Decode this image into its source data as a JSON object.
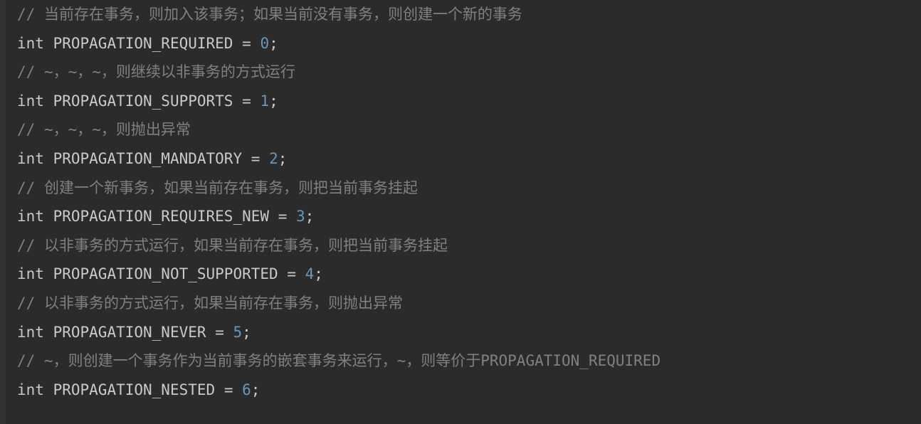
{
  "editor": {
    "theme_name": "darcula",
    "colors": {
      "background": "#2b2b2b",
      "gutter": "#313335",
      "comment": "#808080",
      "code_text": "#c9c9c9",
      "number_literal": "#6897bb"
    },
    "language": "java",
    "lines": [
      {
        "index": 1,
        "type": "comment",
        "slashes": "//",
        "text": " 当前存在事务，则加入该事务；如果当前没有事务，则创建一个新的事务",
        "full": "// 当前存在事务，则加入该事务；如果当前没有事务，则创建一个新的事务"
      },
      {
        "index": 2,
        "type": "code",
        "keyword": "int",
        "identifier": "PROPAGATION_REQUIRED",
        "operator": "=",
        "value": "0",
        "terminator": ";",
        "full": "int PROPAGATION_REQUIRED = 0;"
      },
      {
        "index": 3,
        "type": "comment",
        "slashes": "//",
        "text": " ~，~，~，则继续以非事务的方式运行",
        "full": "// ~，~，~，则继续以非事务的方式运行"
      },
      {
        "index": 4,
        "type": "code",
        "keyword": "int",
        "identifier": "PROPAGATION_SUPPORTS",
        "operator": "=",
        "value": "1",
        "terminator": ";",
        "full": "int PROPAGATION_SUPPORTS = 1;"
      },
      {
        "index": 5,
        "type": "comment",
        "slashes": "//",
        "text": " ~，~，~，则抛出异常",
        "full": "// ~，~，~，则抛出异常"
      },
      {
        "index": 6,
        "type": "code",
        "keyword": "int",
        "identifier": "PROPAGATION_MANDATORY",
        "operator": "=",
        "value": "2",
        "terminator": ";",
        "full": "int PROPAGATION_MANDATORY = 2;"
      },
      {
        "index": 7,
        "type": "comment",
        "slashes": "//",
        "text": " 创建一个新事务，如果当前存在事务，则把当前事务挂起",
        "full": "// 创建一个新事务，如果当前存在事务，则把当前事务挂起"
      },
      {
        "index": 8,
        "type": "code",
        "keyword": "int",
        "identifier": "PROPAGATION_REQUIRES_NEW",
        "operator": "=",
        "value": "3",
        "terminator": ";",
        "full": "int PROPAGATION_REQUIRES_NEW = 3;"
      },
      {
        "index": 9,
        "type": "comment",
        "slashes": "//",
        "text": " 以非事务的方式运行，如果当前存在事务，则把当前事务挂起",
        "full": "// 以非事务的方式运行，如果当前存在事务，则把当前事务挂起"
      },
      {
        "index": 10,
        "type": "code",
        "keyword": "int",
        "identifier": "PROPAGATION_NOT_SUPPORTED",
        "operator": "=",
        "value": "4",
        "terminator": ";",
        "full": "int PROPAGATION_NOT_SUPPORTED = 4;"
      },
      {
        "index": 11,
        "type": "comment",
        "slashes": "//",
        "text": " 以非事务的方式运行，如果当前存在事务，则抛出异常",
        "full": "// 以非事务的方式运行，如果当前存在事务，则抛出异常"
      },
      {
        "index": 12,
        "type": "code",
        "keyword": "int",
        "identifier": "PROPAGATION_NEVER",
        "operator": "=",
        "value": "5",
        "terminator": ";",
        "full": "int PROPAGATION_NEVER = 5;"
      },
      {
        "index": 13,
        "type": "comment",
        "slashes": "//",
        "text": " ~，则创建一个事务作为当前事务的嵌套事务来运行，~，则等价于PROPAGATION_REQUIRED",
        "full": "// ~，则创建一个事务作为当前事务的嵌套事务来运行，~，则等价于PROPAGATION_REQUIRED"
      },
      {
        "index": 14,
        "type": "code",
        "keyword": "int",
        "identifier": "PROPAGATION_NESTED",
        "operator": "=",
        "value": "6",
        "terminator": ";",
        "full": "int PROPAGATION_NESTED = 6;"
      }
    ]
  }
}
